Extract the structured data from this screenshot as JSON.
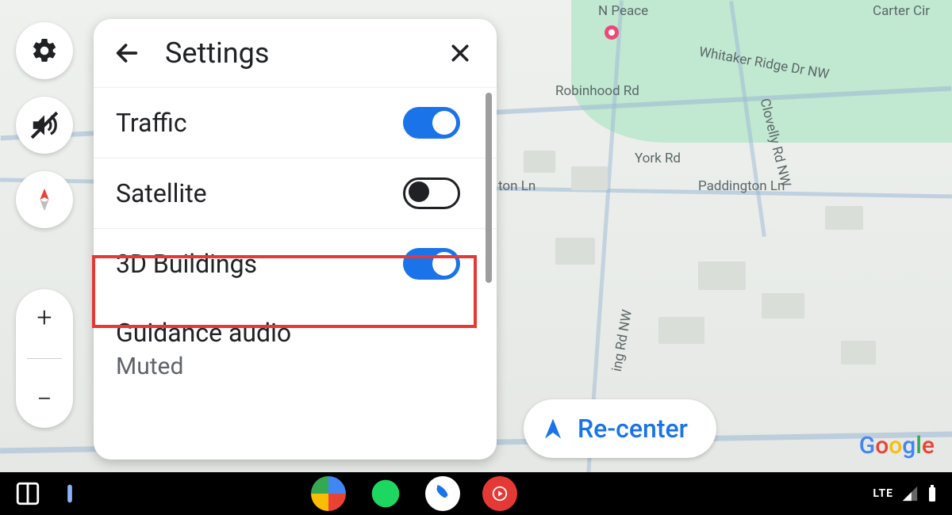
{
  "panel": {
    "title": "Settings",
    "items": [
      {
        "label": "Traffic",
        "toggle": "on"
      },
      {
        "label": "Satellite",
        "toggle": "off"
      },
      {
        "label": "3D Buildings",
        "toggle": "on"
      },
      {
        "label": "Guidance audio"
      }
    ],
    "sub_label": "Muted",
    "highlighted_index": 2
  },
  "side_buttons": {
    "settings_icon": "gear-icon",
    "mute_icon": "volume-muted-icon",
    "compass_icon": "compass-icon"
  },
  "zoom": {
    "in": "+",
    "out": "−"
  },
  "recenter_label": "Re-center",
  "map_roads": [
    "Robinhood Rd",
    "Whitaker Ridge Dr NW",
    "York Rd",
    "Paddington Ln",
    "Clovelly Rd NW",
    "ing Rd NW",
    "N Peace",
    "Carter Cir",
    "ton Ln"
  ],
  "logo_text": "Google",
  "status_bar": {
    "network": "LTE"
  },
  "colors": {
    "accent": "#1a73e8",
    "highlight": "#e53935"
  }
}
